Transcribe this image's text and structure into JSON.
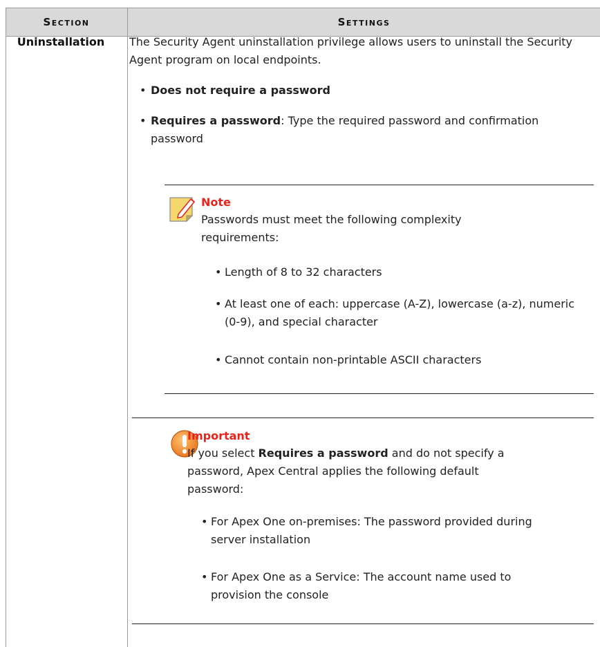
{
  "header": {
    "section": "Section",
    "settings": "Settings"
  },
  "row": {
    "section": "Uninstallation",
    "intro": "The Security Agent uninstallation privilege allows users to uninstall the Security Agent program on local endpoints.",
    "options": [
      {
        "bold": "Does not require a password",
        "rest": ""
      },
      {
        "bold": "Requires a password",
        "rest": ": Type the required password and confirmation password"
      }
    ]
  },
  "note": {
    "icon": "note-pencil-icon",
    "title": "Note",
    "text": "Passwords must meet the following complexity requirements:",
    "items": [
      "Length of 8 to 32 characters",
      "At least one of each: uppercase (A-Z), lowercase (a-z), numeric (0-9), and special character",
      "Cannot contain non-printable ASCII characters"
    ]
  },
  "important": {
    "icon": "exclamation-icon",
    "title": "Important",
    "text_pre": "If you select ",
    "text_bold": "Requires a password",
    "text_post": " and do not specify a password, Apex Central applies the following default password:",
    "items": [
      "For Apex One on-premises: The password provided during server installation",
      "For Apex One as a Service: The account name used to provision the console"
    ]
  },
  "colors": {
    "header_bg": "#d9d9d9",
    "callout_title": "#e8251c",
    "note_icon": "#f5d76e",
    "important_icon": "#f08a24"
  }
}
